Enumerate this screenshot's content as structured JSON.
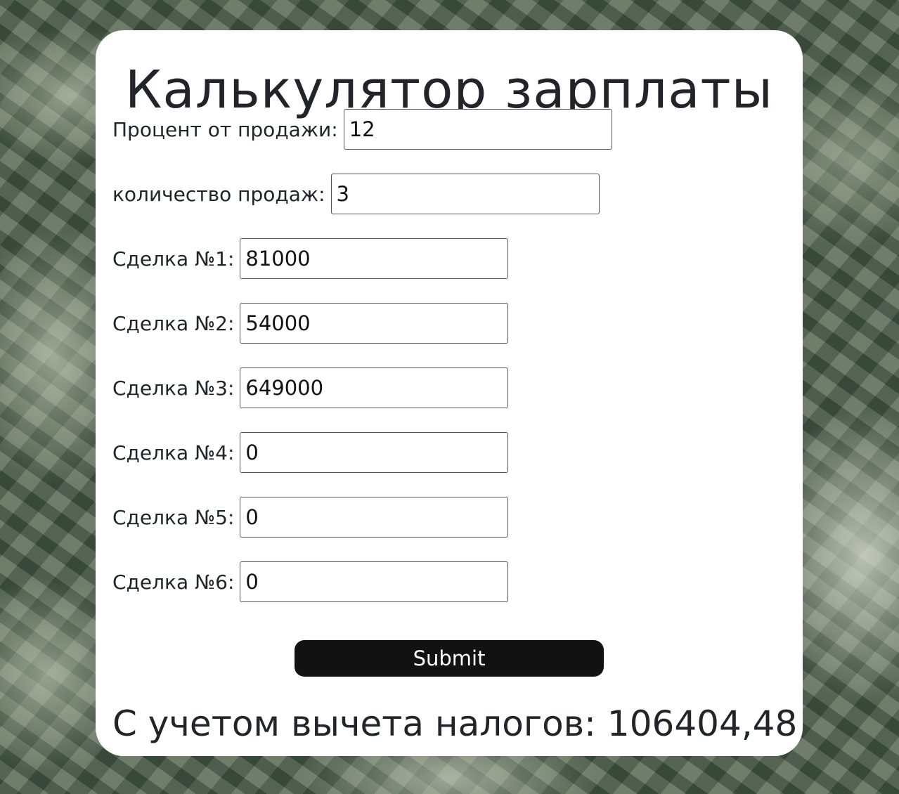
{
  "page": {
    "title": "Калькулятор зарплаты"
  },
  "form": {
    "fields": [
      {
        "label": "Процент от продажи:",
        "value": "12"
      },
      {
        "label": "количество продаж:",
        "value": "3"
      },
      {
        "label": "Сделка №1:",
        "value": "81000"
      },
      {
        "label": "Сделка №2:",
        "value": "54000"
      },
      {
        "label": "Сделка №3:",
        "value": "649000"
      },
      {
        "label": "Сделка №4:",
        "value": "0"
      },
      {
        "label": "Сделка №5:",
        "value": "0"
      },
      {
        "label": "Сделка №6:",
        "value": "0"
      }
    ],
    "submit_label": "Submit"
  },
  "result": {
    "text": "С учетом вычета налогов: 106404,48"
  },
  "colors": {
    "card": "#ffffff",
    "text": "#212529",
    "button": "#121212",
    "button_text": "#ffffff"
  }
}
